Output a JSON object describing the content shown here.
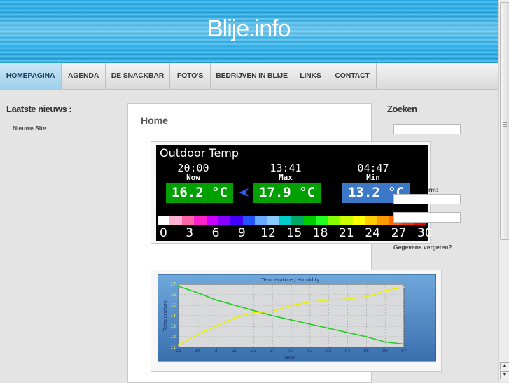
{
  "site": {
    "title": "Blije.info"
  },
  "nav": {
    "items": [
      "HOMEPAGINA",
      "AGENDA",
      "DE SNACKBAR",
      "FOTO'S",
      "BEDRIJVEN IN BLIJE",
      "LINKS",
      "CONTACT"
    ],
    "active": "HOMEPAGINA"
  },
  "sidebar": {
    "heading": "Laatste nieuws :",
    "items": [
      "Nieuwe Site"
    ]
  },
  "main": {
    "title": "Home"
  },
  "temp_widget": {
    "title": "Outdoor Temp",
    "now": {
      "time": "20:00",
      "label": "Now",
      "value": "16.2 °C"
    },
    "max": {
      "time": "13:41",
      "label": "Max",
      "value": "17.9 °C"
    },
    "min": {
      "time": "04:47",
      "label": "Min",
      "value": "13.2 °C"
    },
    "scale": [
      "0",
      "3",
      "6",
      "9",
      "12",
      "15",
      "18",
      "21",
      "24",
      "27",
      "30"
    ],
    "colors": {
      "now": "#00a000",
      "max": "#00a000",
      "min": "#3c78c8"
    }
  },
  "chart_data": {
    "type": "line",
    "title": "Temperature / Humidity",
    "xlabel": "Hour",
    "ylabel": "Temperature",
    "x": [
      "21",
      "20",
      "2",
      "22",
      "23",
      "24",
      "01",
      "02",
      "03",
      "04",
      "05",
      "06",
      "07"
    ],
    "ylim": [
      11,
      17
    ],
    "series": [
      {
        "color": "#22cc22",
        "values": [
          16.8,
          16.2,
          15.5,
          15.0,
          14.5,
          14.0,
          13.6,
          13.2,
          12.8,
          12.4,
          12.0,
          11.5,
          11.3
        ]
      },
      {
        "color": "#eeee00",
        "values": [
          11.2,
          12.2,
          13.0,
          13.8,
          14.3,
          14.4,
          15.0,
          15.3,
          15.5,
          15.6,
          15.8,
          16.4,
          16.7
        ]
      }
    ]
  },
  "search": {
    "heading": "Zoeken"
  },
  "login": {
    "label_partial": "rm:",
    "forgot": "Gegevens vergeten?"
  }
}
